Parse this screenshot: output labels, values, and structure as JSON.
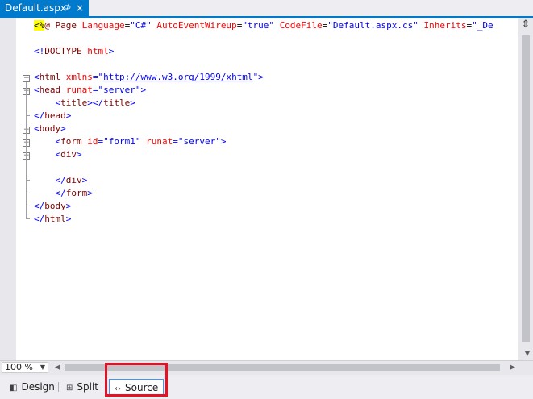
{
  "tab": {
    "title": "Default.aspx",
    "pin_glyph": "⊅",
    "close_glyph": "×"
  },
  "editor": {
    "lines": [
      [
        {
          "c": "dir",
          "t": "<%"
        },
        {
          "c": "tag",
          "t": "@ Page "
        },
        {
          "c": "attr",
          "t": "Language"
        },
        {
          "c": "",
          "t": "="
        },
        {
          "c": "val",
          "t": "\"C#\""
        },
        {
          "c": "",
          "t": " "
        },
        {
          "c": "attr",
          "t": "AutoEventWireup"
        },
        {
          "c": "",
          "t": "="
        },
        {
          "c": "val",
          "t": "\"true\""
        },
        {
          "c": "",
          "t": " "
        },
        {
          "c": "attr",
          "t": "CodeFile"
        },
        {
          "c": "",
          "t": "="
        },
        {
          "c": "val",
          "t": "\"Default.aspx.cs\""
        },
        {
          "c": "",
          "t": " "
        },
        {
          "c": "attr",
          "t": "Inherits"
        },
        {
          "c": "",
          "t": "="
        },
        {
          "c": "val",
          "t": "\"_De"
        }
      ],
      [],
      [
        {
          "c": "bracket",
          "t": "<!"
        },
        {
          "c": "tag",
          "t": "DOCTYPE"
        },
        {
          "c": "",
          "t": " "
        },
        {
          "c": "attr",
          "t": "html"
        },
        {
          "c": "bracket",
          "t": ">"
        }
      ],
      [],
      [
        {
          "c": "bracket",
          "t": "<"
        },
        {
          "c": "tag",
          "t": "html"
        },
        {
          "c": "",
          "t": " "
        },
        {
          "c": "attr",
          "t": "xmlns"
        },
        {
          "c": "bracket",
          "t": "=\""
        },
        {
          "c": "url",
          "t": "http://www.w3.org/1999/xhtml"
        },
        {
          "c": "bracket",
          "t": "\">"
        }
      ],
      [
        {
          "c": "bracket",
          "t": "<"
        },
        {
          "c": "tag",
          "t": "head"
        },
        {
          "c": "",
          "t": " "
        },
        {
          "c": "attr",
          "t": "runat"
        },
        {
          "c": "bracket",
          "t": "="
        },
        {
          "c": "val",
          "t": "\"server\""
        },
        {
          "c": "bracket",
          "t": ">"
        }
      ],
      [
        {
          "c": "",
          "t": "    "
        },
        {
          "c": "bracket",
          "t": "<"
        },
        {
          "c": "tag",
          "t": "title"
        },
        {
          "c": "bracket",
          "t": "></"
        },
        {
          "c": "tag",
          "t": "title"
        },
        {
          "c": "bracket",
          "t": ">"
        }
      ],
      [
        {
          "c": "bracket",
          "t": "</"
        },
        {
          "c": "tag",
          "t": "head"
        },
        {
          "c": "bracket",
          "t": ">"
        }
      ],
      [
        {
          "c": "bracket",
          "t": "<"
        },
        {
          "c": "tag",
          "t": "body"
        },
        {
          "c": "bracket",
          "t": ">"
        }
      ],
      [
        {
          "c": "",
          "t": "    "
        },
        {
          "c": "bracket",
          "t": "<"
        },
        {
          "c": "tag",
          "t": "form"
        },
        {
          "c": "",
          "t": " "
        },
        {
          "c": "attr",
          "t": "id"
        },
        {
          "c": "bracket",
          "t": "="
        },
        {
          "c": "val",
          "t": "\"form1\""
        },
        {
          "c": "",
          "t": " "
        },
        {
          "c": "attr",
          "t": "runat"
        },
        {
          "c": "bracket",
          "t": "="
        },
        {
          "c": "val",
          "t": "\"server\""
        },
        {
          "c": "bracket",
          "t": ">"
        }
      ],
      [
        {
          "c": "",
          "t": "    "
        },
        {
          "c": "bracket",
          "t": "<"
        },
        {
          "c": "tag",
          "t": "div"
        },
        {
          "c": "bracket",
          "t": ">"
        }
      ],
      [],
      [
        {
          "c": "",
          "t": "    "
        },
        {
          "c": "bracket",
          "t": "</"
        },
        {
          "c": "tag",
          "t": "div"
        },
        {
          "c": "bracket",
          "t": ">"
        }
      ],
      [
        {
          "c": "",
          "t": "    "
        },
        {
          "c": "bracket",
          "t": "</"
        },
        {
          "c": "tag",
          "t": "form"
        },
        {
          "c": "bracket",
          "t": ">"
        }
      ],
      [
        {
          "c": "bracket",
          "t": "</"
        },
        {
          "c": "tag",
          "t": "body"
        },
        {
          "c": "bracket",
          "t": ">"
        }
      ],
      [
        {
          "c": "bracket",
          "t": "</"
        },
        {
          "c": "tag",
          "t": "html"
        },
        {
          "c": "bracket",
          "t": ">"
        }
      ]
    ]
  },
  "scroll": {
    "split_glyph": "⇕"
  },
  "zoom": {
    "value": "100 %"
  },
  "views": {
    "design": {
      "label": "Design",
      "icon": "◧"
    },
    "split": {
      "label": "Split",
      "icon": "⊞"
    },
    "source": {
      "label": "Source",
      "icon": "‹›"
    }
  },
  "colors": {
    "accent": "#007acc",
    "tag": "#800000",
    "attr": "#ff0000",
    "value": "#0000ff",
    "highlight": "#e81123",
    "directive_bg": "#ffff00"
  }
}
